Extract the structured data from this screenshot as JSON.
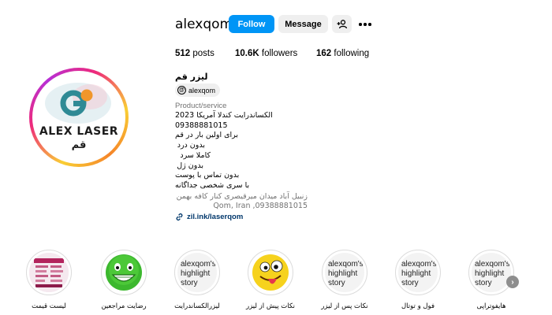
{
  "profile": {
    "username": "alexqom",
    "avatar_brand": "ALEX LASER",
    "avatar_brand_sub": "قم"
  },
  "actions": {
    "follow_label": "Follow",
    "message_label": "Message",
    "add_user_icon": "person-plus-icon",
    "more_icon": "more-icon"
  },
  "stats": {
    "posts_count": "512",
    "posts_label": "posts",
    "followers_count": "10.6K",
    "followers_label": "followers",
    "following_count": "162",
    "following_label": "following"
  },
  "bio": {
    "name": "لیزر قم",
    "threads_handle": "alexqom",
    "category": "Product/service",
    "lines": [
      "الکساندرایت کندلا آمریکا 2023",
      "09388881015",
      "برای اولین بار در قم",
      "بدون درد",
      "کاملا سرد",
      "بدون ژل",
      "بدون تماس با پوست",
      "با سری شخصی جداگانه"
    ],
    "address_lines": [
      "زنبیل آباد میدان میرقیصری کنار کافه بهمن",
      "Qom, Iran ,09388881015"
    ],
    "link": "zil.ink/laserqom"
  },
  "highlights": [
    {
      "label": "لیست قیمت",
      "cover_text": ""
    },
    {
      "label": "رضایت مراجعین",
      "cover_text": ""
    },
    {
      "label": "لیزرالکساندرایت",
      "cover_text": ""
    },
    {
      "label": "نکات پیش از لیزر",
      "cover_text": ""
    },
    {
      "label": "نکات پس از لیزر",
      "cover_text": "alexqom's highlight story"
    },
    {
      "label": "فول و توتال",
      "cover_text": "alexqom's highlight story"
    },
    {
      "label": "هایفوتراپی",
      "cover_text": "alexqom's highlight story"
    }
  ],
  "colors": {
    "follow_blue": "#0095f6",
    "link_color": "#00376b",
    "muted_text": "#737373"
  }
}
